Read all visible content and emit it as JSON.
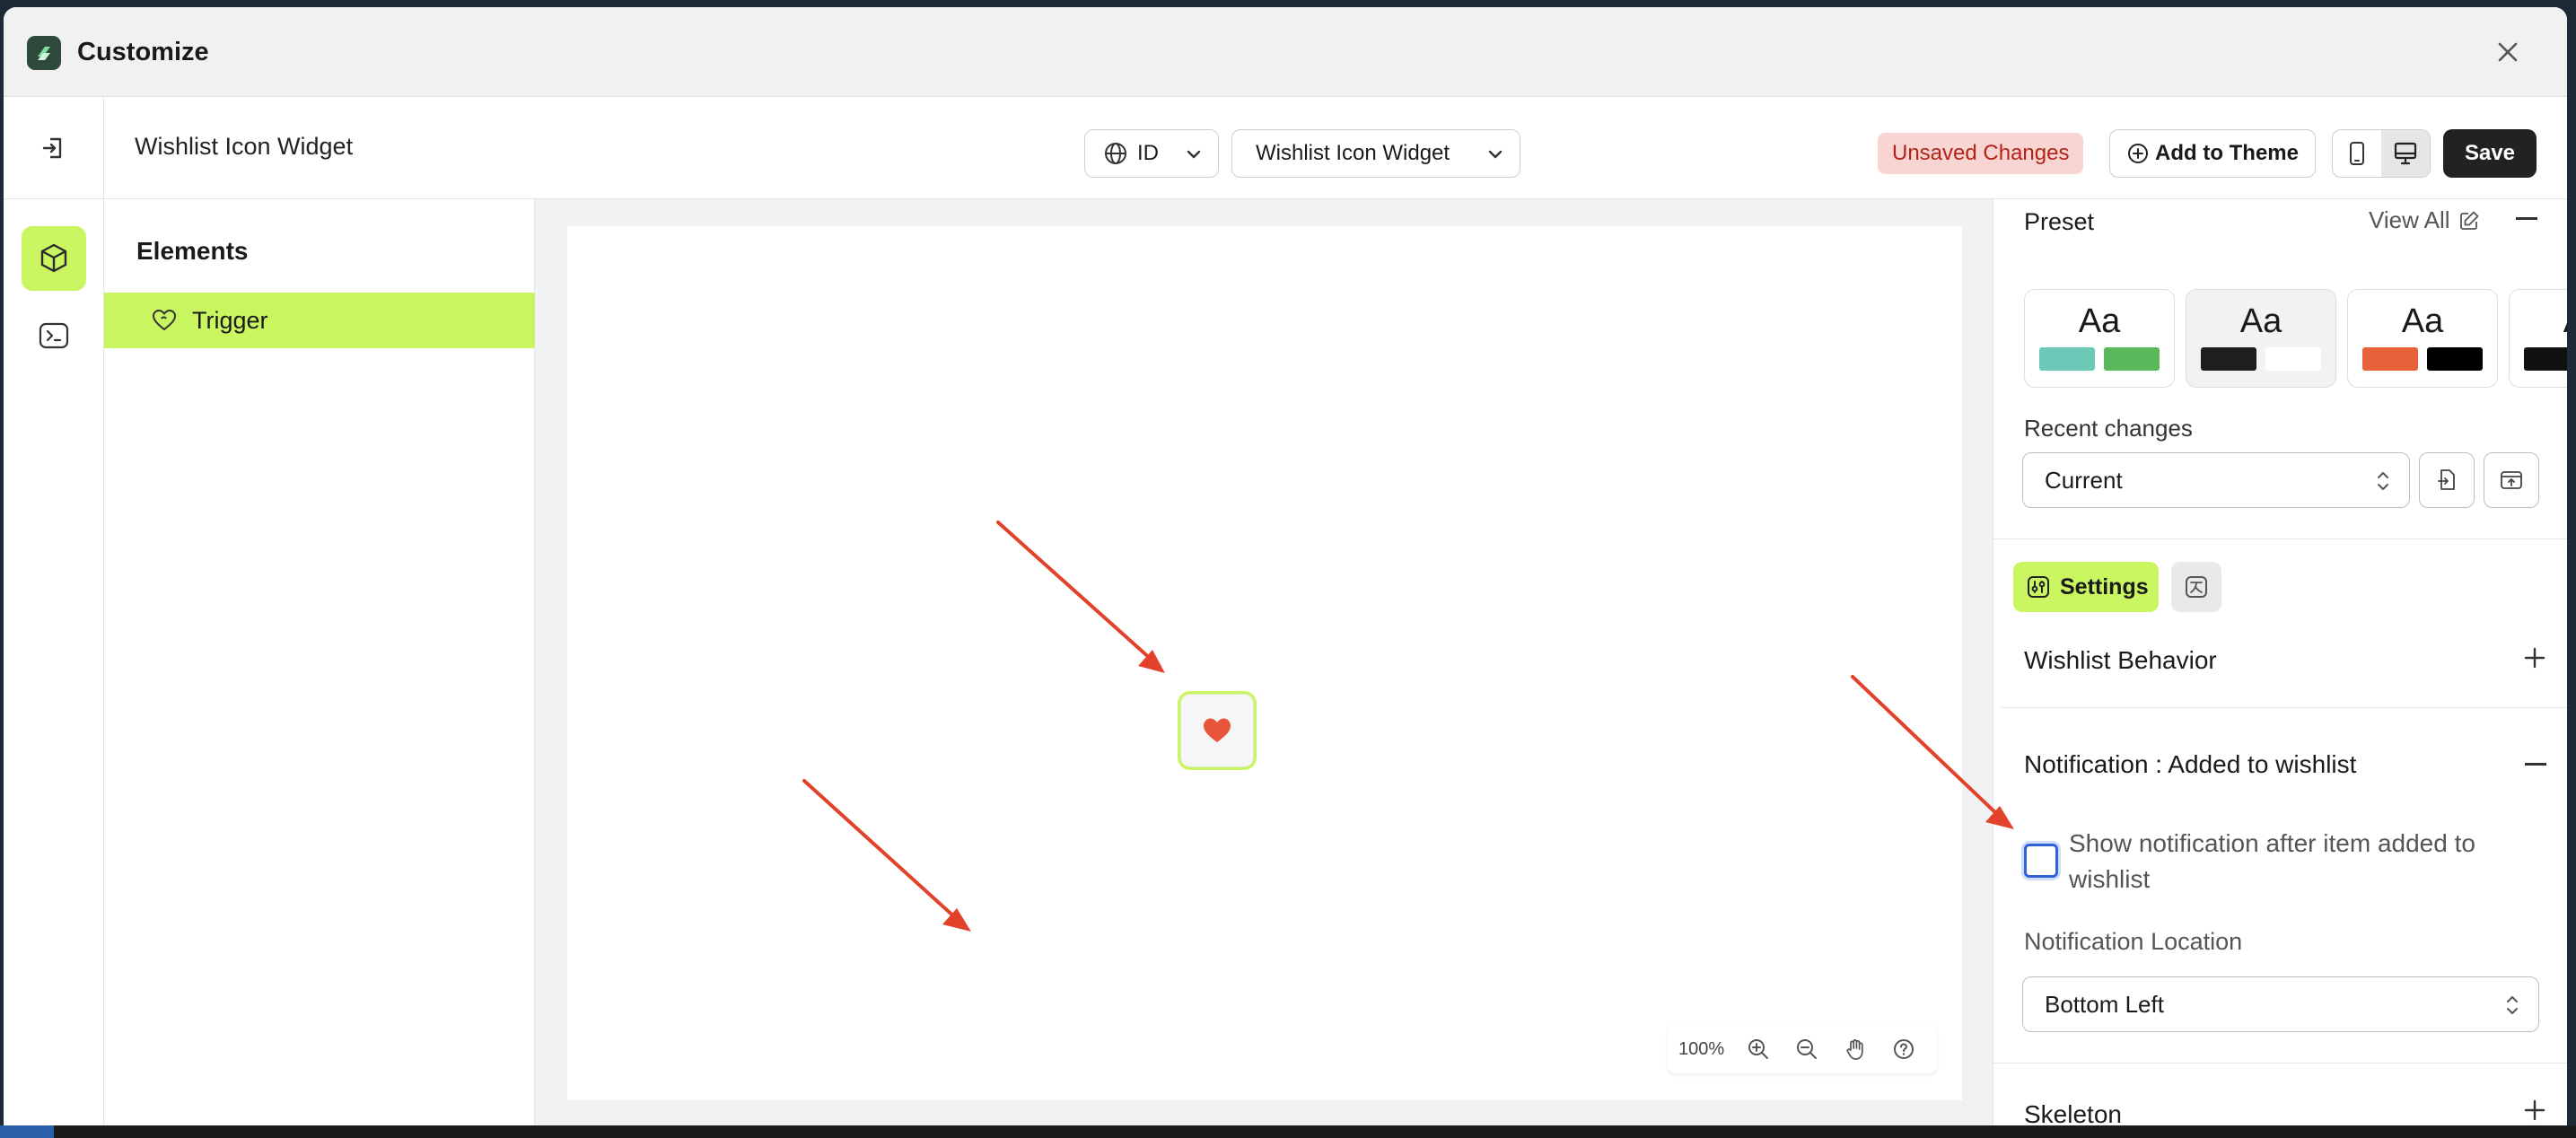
{
  "window": {
    "title": "Customize"
  },
  "toolbar": {
    "page_title": "Wishlist Icon Widget",
    "language": "ID",
    "widget_select": "Wishlist Icon Widget",
    "unsaved_badge": "Unsaved Changes",
    "add_to_theme": "Add to Theme",
    "save": "Save"
  },
  "elements_panel": {
    "title": "Elements",
    "items": [
      {
        "label": "Trigger"
      }
    ]
  },
  "canvas": {
    "zoom": "100%"
  },
  "right_panel": {
    "preset": {
      "title": "Preset",
      "view_all": "View All",
      "cards": [
        {
          "label": "Aa",
          "colors": [
            "#6cc9b7",
            "#58b85a"
          ]
        },
        {
          "label": "Aa",
          "colors": [
            "#1e1e1e",
            "#ffffff"
          ]
        },
        {
          "label": "Aa",
          "colors": [
            "#e8613b",
            "#000000"
          ]
        },
        {
          "label": "Aa",
          "colors": [
            "#111111",
            "#ffffff"
          ]
        }
      ]
    },
    "recent_changes": {
      "label": "Recent changes",
      "value": "Current"
    },
    "tabs": {
      "settings": "Settings"
    },
    "sections": {
      "wishlist_behavior": "Wishlist Behavior",
      "notification": "Notification : Added to wishlist",
      "show_notification": "Show notification after item added to wishlist",
      "show_notification_checked": false,
      "location_label": "Notification Location",
      "location_value": "Bottom Left",
      "skeleton": "Skeleton"
    }
  },
  "colors": {
    "accent": "#c8f560",
    "arrow": "#e2412a",
    "heart": "#e9553a",
    "checkbox_focus": "#2f63d6",
    "unsaved_bg": "#f8d4d2",
    "unsaved_text": "#b42318"
  }
}
